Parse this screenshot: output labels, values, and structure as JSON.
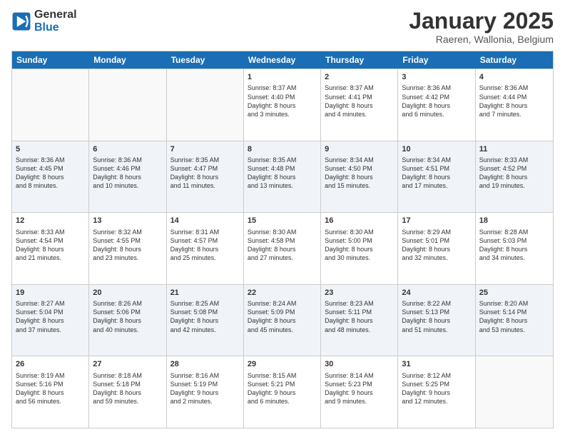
{
  "logo": {
    "line1": "General",
    "line2": "Blue"
  },
  "title": "January 2025",
  "location": "Raeren, Wallonia, Belgium",
  "days": [
    "Sunday",
    "Monday",
    "Tuesday",
    "Wednesday",
    "Thursday",
    "Friday",
    "Saturday"
  ],
  "rows": [
    [
      {
        "day": "",
        "text": ""
      },
      {
        "day": "",
        "text": ""
      },
      {
        "day": "",
        "text": ""
      },
      {
        "day": "1",
        "text": "Sunrise: 8:37 AM\nSunset: 4:40 PM\nDaylight: 8 hours\nand 3 minutes."
      },
      {
        "day": "2",
        "text": "Sunrise: 8:37 AM\nSunset: 4:41 PM\nDaylight: 8 hours\nand 4 minutes."
      },
      {
        "day": "3",
        "text": "Sunrise: 8:36 AM\nSunset: 4:42 PM\nDaylight: 8 hours\nand 6 minutes."
      },
      {
        "day": "4",
        "text": "Sunrise: 8:36 AM\nSunset: 4:44 PM\nDaylight: 8 hours\nand 7 minutes."
      }
    ],
    [
      {
        "day": "5",
        "text": "Sunrise: 8:36 AM\nSunset: 4:45 PM\nDaylight: 8 hours\nand 8 minutes."
      },
      {
        "day": "6",
        "text": "Sunrise: 8:36 AM\nSunset: 4:46 PM\nDaylight: 8 hours\nand 10 minutes."
      },
      {
        "day": "7",
        "text": "Sunrise: 8:35 AM\nSunset: 4:47 PM\nDaylight: 8 hours\nand 11 minutes."
      },
      {
        "day": "8",
        "text": "Sunrise: 8:35 AM\nSunset: 4:48 PM\nDaylight: 8 hours\nand 13 minutes."
      },
      {
        "day": "9",
        "text": "Sunrise: 8:34 AM\nSunset: 4:50 PM\nDaylight: 8 hours\nand 15 minutes."
      },
      {
        "day": "10",
        "text": "Sunrise: 8:34 AM\nSunset: 4:51 PM\nDaylight: 8 hours\nand 17 minutes."
      },
      {
        "day": "11",
        "text": "Sunrise: 8:33 AM\nSunset: 4:52 PM\nDaylight: 8 hours\nand 19 minutes."
      }
    ],
    [
      {
        "day": "12",
        "text": "Sunrise: 8:33 AM\nSunset: 4:54 PM\nDaylight: 8 hours\nand 21 minutes."
      },
      {
        "day": "13",
        "text": "Sunrise: 8:32 AM\nSunset: 4:55 PM\nDaylight: 8 hours\nand 23 minutes."
      },
      {
        "day": "14",
        "text": "Sunrise: 8:31 AM\nSunset: 4:57 PM\nDaylight: 8 hours\nand 25 minutes."
      },
      {
        "day": "15",
        "text": "Sunrise: 8:30 AM\nSunset: 4:58 PM\nDaylight: 8 hours\nand 27 minutes."
      },
      {
        "day": "16",
        "text": "Sunrise: 8:30 AM\nSunset: 5:00 PM\nDaylight: 8 hours\nand 30 minutes."
      },
      {
        "day": "17",
        "text": "Sunrise: 8:29 AM\nSunset: 5:01 PM\nDaylight: 8 hours\nand 32 minutes."
      },
      {
        "day": "18",
        "text": "Sunrise: 8:28 AM\nSunset: 5:03 PM\nDaylight: 8 hours\nand 34 minutes."
      }
    ],
    [
      {
        "day": "19",
        "text": "Sunrise: 8:27 AM\nSunset: 5:04 PM\nDaylight: 8 hours\nand 37 minutes."
      },
      {
        "day": "20",
        "text": "Sunrise: 8:26 AM\nSunset: 5:06 PM\nDaylight: 8 hours\nand 40 minutes."
      },
      {
        "day": "21",
        "text": "Sunrise: 8:25 AM\nSunset: 5:08 PM\nDaylight: 8 hours\nand 42 minutes."
      },
      {
        "day": "22",
        "text": "Sunrise: 8:24 AM\nSunset: 5:09 PM\nDaylight: 8 hours\nand 45 minutes."
      },
      {
        "day": "23",
        "text": "Sunrise: 8:23 AM\nSunset: 5:11 PM\nDaylight: 8 hours\nand 48 minutes."
      },
      {
        "day": "24",
        "text": "Sunrise: 8:22 AM\nSunset: 5:13 PM\nDaylight: 8 hours\nand 51 minutes."
      },
      {
        "day": "25",
        "text": "Sunrise: 8:20 AM\nSunset: 5:14 PM\nDaylight: 8 hours\nand 53 minutes."
      }
    ],
    [
      {
        "day": "26",
        "text": "Sunrise: 8:19 AM\nSunset: 5:16 PM\nDaylight: 8 hours\nand 56 minutes."
      },
      {
        "day": "27",
        "text": "Sunrise: 8:18 AM\nSunset: 5:18 PM\nDaylight: 8 hours\nand 59 minutes."
      },
      {
        "day": "28",
        "text": "Sunrise: 8:16 AM\nSunset: 5:19 PM\nDaylight: 9 hours\nand 2 minutes."
      },
      {
        "day": "29",
        "text": "Sunrise: 8:15 AM\nSunset: 5:21 PM\nDaylight: 9 hours\nand 6 minutes."
      },
      {
        "day": "30",
        "text": "Sunrise: 8:14 AM\nSunset: 5:23 PM\nDaylight: 9 hours\nand 9 minutes."
      },
      {
        "day": "31",
        "text": "Sunrise: 8:12 AM\nSunset: 5:25 PM\nDaylight: 9 hours\nand 12 minutes."
      },
      {
        "day": "",
        "text": ""
      }
    ]
  ]
}
